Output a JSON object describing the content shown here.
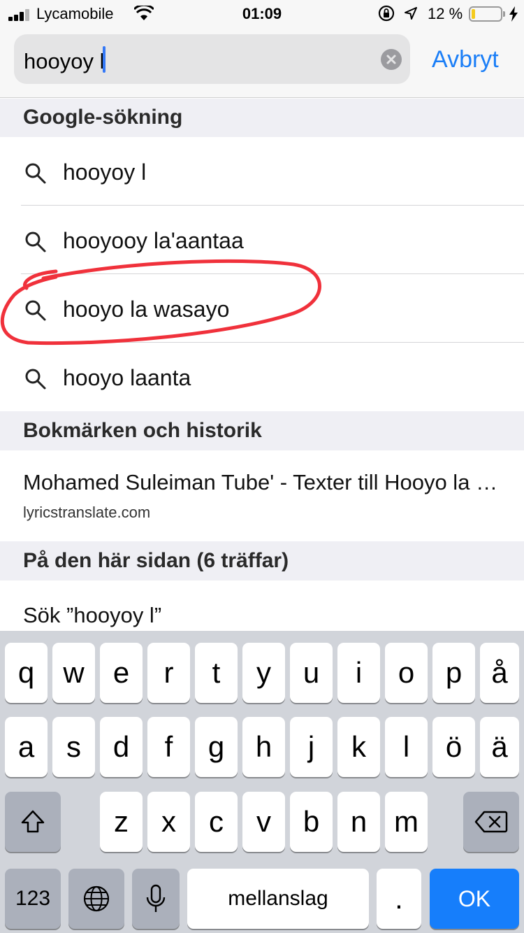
{
  "status": {
    "carrier": "Lycamobile",
    "time": "01:09",
    "battery_percent": "12 %",
    "battery_level": 0.12,
    "battery_color": "#f5cb1d"
  },
  "search": {
    "value": "hooyoy l",
    "cancel_label": "Avbryt",
    "accent_color": "#1a7ef7"
  },
  "sections": {
    "google": "Google-sökning",
    "bookmarks": "Bokmärken och historik",
    "on_page": "På den här sidan (6 träffar)"
  },
  "suggestions": [
    {
      "label": "hooyoy l",
      "icon": "magnifier-icon"
    },
    {
      "label": "hooyooy la'aantaa",
      "icon": "magnifier-icon"
    },
    {
      "label": "hooyo la wasayo",
      "icon": "magnifier-icon"
    },
    {
      "label": "hooyo laanta",
      "icon": "magnifier-icon"
    }
  ],
  "bookmark": {
    "title": "Mohamed Suleiman Tube' - Texter till Hooyo la wasayo",
    "url": "lyricstranslate.com"
  },
  "find_on_page": "Sök ”hooyoy l”",
  "keyboard": {
    "row1": [
      "q",
      "w",
      "e",
      "r",
      "t",
      "y",
      "u",
      "i",
      "o",
      "p",
      "å"
    ],
    "row2": [
      "a",
      "s",
      "d",
      "f",
      "g",
      "h",
      "j",
      "k",
      "l",
      "ö",
      "ä"
    ],
    "row3": [
      "z",
      "x",
      "c",
      "v",
      "b",
      "n",
      "m"
    ],
    "numbers_label": "123",
    "space_label": "mellanslag",
    "period_label": ".",
    "ok_label": "OK"
  }
}
